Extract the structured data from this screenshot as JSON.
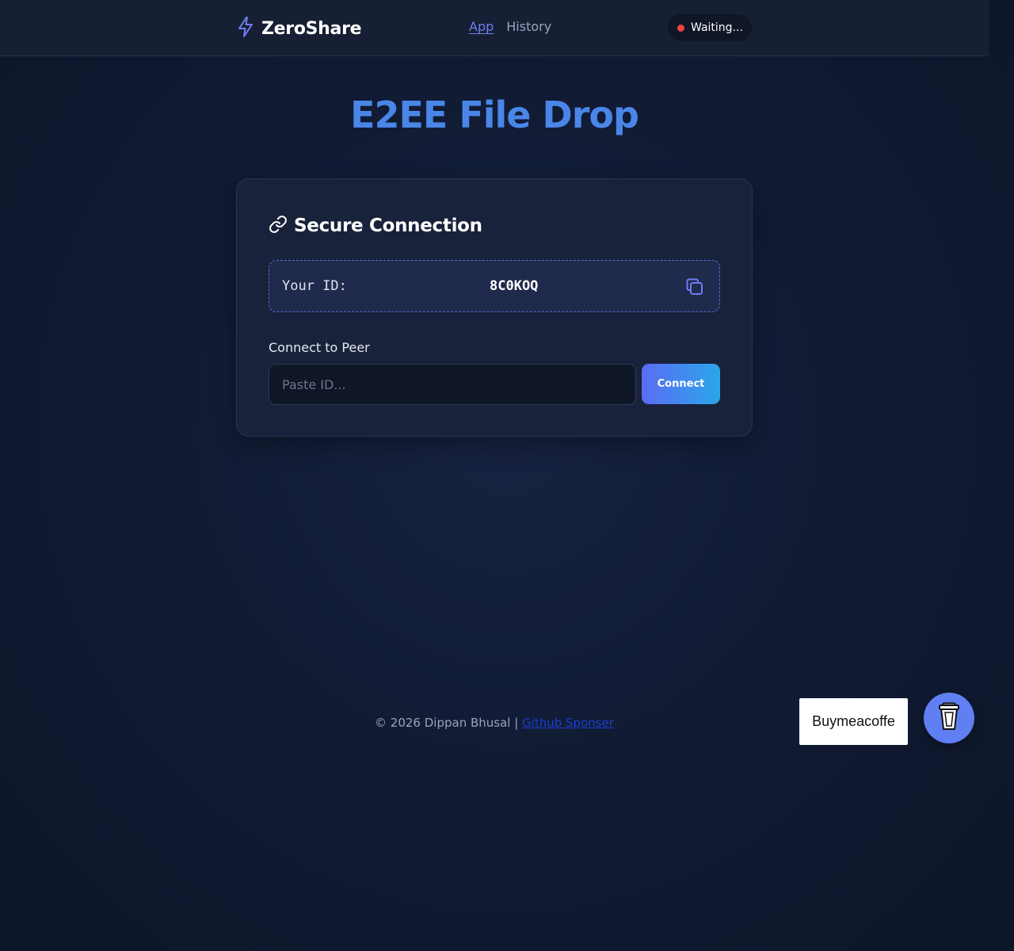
{
  "header": {
    "brand": "ZeroShare",
    "nav": [
      {
        "label": "App",
        "active": true
      },
      {
        "label": "History",
        "active": false
      }
    ],
    "status": "Waiting..."
  },
  "main": {
    "title": "E2EE File Drop",
    "card": {
      "title": "Secure Connection",
      "id_label": "Your ID:",
      "id_value": "8C0KOQ",
      "peer_label": "Connect to Peer",
      "peer_placeholder": "Paste ID...",
      "peer_value": "",
      "connect_label": "Connect"
    }
  },
  "footer": {
    "copyright": "© 2026 Dippan Bhusal | ",
    "link_label": "Github Sponser"
  },
  "bmc": {
    "tooltip": "Buymeacoffe"
  },
  "colors": {
    "accent": "#6f7cf2",
    "title": "#4a86e8",
    "status_dot": "#ef4444",
    "bmc_button": "#5f7ff2"
  },
  "icons": {
    "brand": "lightning-bolt-icon",
    "card": "link-icon",
    "copy": "copy-icon",
    "bmc": "coffee-cup-icon"
  }
}
